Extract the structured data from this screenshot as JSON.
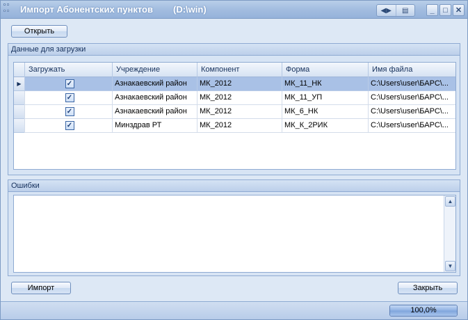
{
  "window": {
    "title": "Импорт Абонентских пунктов",
    "path": "(D:\\win)",
    "controls": {
      "minimize": "_",
      "maximize": "□",
      "close": "✕"
    },
    "toolbar_icons": [
      "layout-arrows-icon",
      "export-icon"
    ]
  },
  "toolbar": {
    "open_label": "Открыть"
  },
  "data_panel": {
    "title": "Данные для загрузки",
    "columns": [
      "Загружать",
      "Учреждение",
      "Компонент",
      "Форма",
      "Имя файла"
    ],
    "rows": [
      {
        "load": true,
        "institution": "Азнакаевский район",
        "component": "МК_2012",
        "form": "МК_11_НК",
        "file": "C:\\Users\\user\\БАРС\\...",
        "selected": true
      },
      {
        "load": true,
        "institution": "Азнакаевский район",
        "component": "МК_2012",
        "form": "МК_11_УП",
        "file": "C:\\Users\\user\\БАРС\\...",
        "selected": false
      },
      {
        "load": true,
        "institution": "Азнакаевский район",
        "component": "МК_2012",
        "form": "МК_6_НК",
        "file": "C:\\Users\\user\\БАРС\\...",
        "selected": false
      },
      {
        "load": true,
        "institution": "Минздрав РТ",
        "component": "МК_2012",
        "form": "МК_К_2РИК",
        "file": "C:\\Users\\user\\БАРС\\...",
        "selected": false
      }
    ]
  },
  "errors_panel": {
    "title": "Ошибки",
    "text": ""
  },
  "footer": {
    "import_label": "Импорт",
    "close_label": "Закрыть"
  },
  "status": {
    "progress_text": "100,0%",
    "progress_fraction": 1.0
  }
}
